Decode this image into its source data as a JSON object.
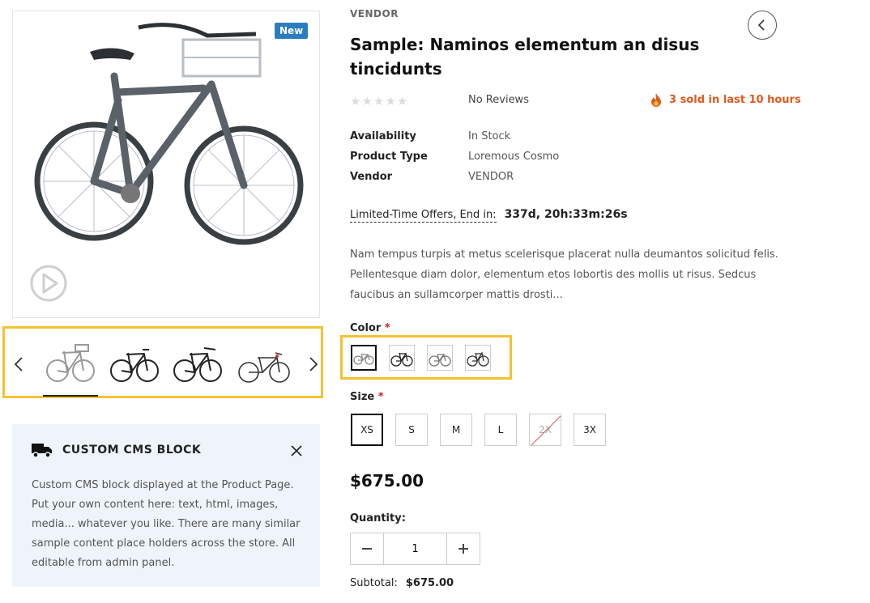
{
  "gallery": {
    "badge": "New",
    "thumb_count": 4
  },
  "cms": {
    "title": "CUSTOM CMS BLOCK",
    "text": "Custom CMS block displayed at the Product Page. Put your own content here: text, html, images, media... whatever you like. There are many similar sample content place holders across the store. All editable from admin panel."
  },
  "product": {
    "vendor_label": "VENDOR",
    "title": "Sample: Naminos elementum an disus tincidunts",
    "rating_stars": 5,
    "rating_value": 0,
    "reviews": "No Reviews",
    "sold": "3 sold in last 10 hours",
    "info": [
      {
        "key": "Availability",
        "value": "In Stock"
      },
      {
        "key": "Product Type",
        "value": "Loremous Cosmo"
      },
      {
        "key": "Vendor",
        "value": "VENDOR"
      }
    ],
    "offer_label": "Limited-Time Offers, End in:",
    "offer_time": "337d, 20h:33m:26s",
    "description": "Nam tempus turpis at metus scelerisque placerat nulla deumantos solicitud felis. Pellentesque diam dolor, elementum etos lobortis des mollis ut risus. Sedcus faucibus an sullamcorper mattis drosti...",
    "color_label": "Color",
    "size_label": "Size",
    "required_mark": "*",
    "sizes": [
      {
        "label": "XS",
        "selected": true
      },
      {
        "label": "S"
      },
      {
        "label": "M"
      },
      {
        "label": "L"
      },
      {
        "label": "2X",
        "unavailable": true
      },
      {
        "label": "3X"
      }
    ],
    "price": "$675.00",
    "quantity_label": "Quantity:",
    "quantity": "1",
    "subtotal_label": "Subtotal:",
    "subtotal": "$675.00"
  },
  "colors": {
    "accent": "#f3c233",
    "badge": "#2c7dbf",
    "hot": "#e05a1f"
  }
}
